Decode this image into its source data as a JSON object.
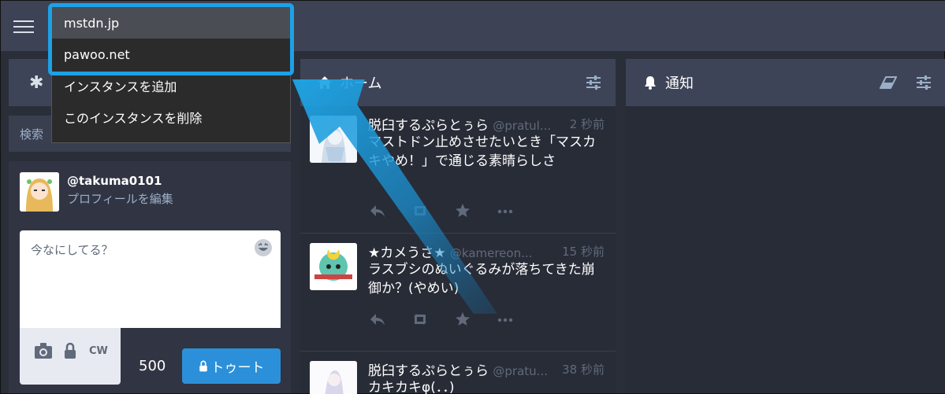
{
  "topbar": {
    "menu_icon": "hamburger-icon"
  },
  "dropdown": {
    "instances": [
      "mstdn.jp",
      "pawoo.net"
    ],
    "actions": [
      "インスタンスを追加",
      "このインスタンスを削除"
    ]
  },
  "left": {
    "search_placeholder": "検索",
    "account": "@takuma0101",
    "edit_profile": "プロフィールを編集",
    "compose_placeholder": "今なにしてる？",
    "cw": "CW",
    "counter": "500",
    "toot": "トゥート"
  },
  "home": {
    "title": "ホーム",
    "statuses": [
      {
        "name": "脱臼するぷらとぅら",
        "handle": "@pratul...",
        "time": "2 秒前",
        "content": "マストドン止めさせたいとき「マスカキやめ！」で通じる素晴らしさ"
      },
      {
        "name": "★カメうさ★",
        "handle": "@kamereon...",
        "time": "15 秒前",
        "content": "ラスブシのぬいぐるみが落ちてきた崩御か？(やめい)"
      },
      {
        "name": "脱臼するぷらとぅら",
        "handle": "@pratu...",
        "time": "38 秒前",
        "content": "カキカキφ(．．)"
      }
    ]
  },
  "notifications": {
    "title": "通知"
  },
  "colors": {
    "accent": "#1da1e6",
    "toot_button": "#2b90d9",
    "header": "#3e4457"
  }
}
